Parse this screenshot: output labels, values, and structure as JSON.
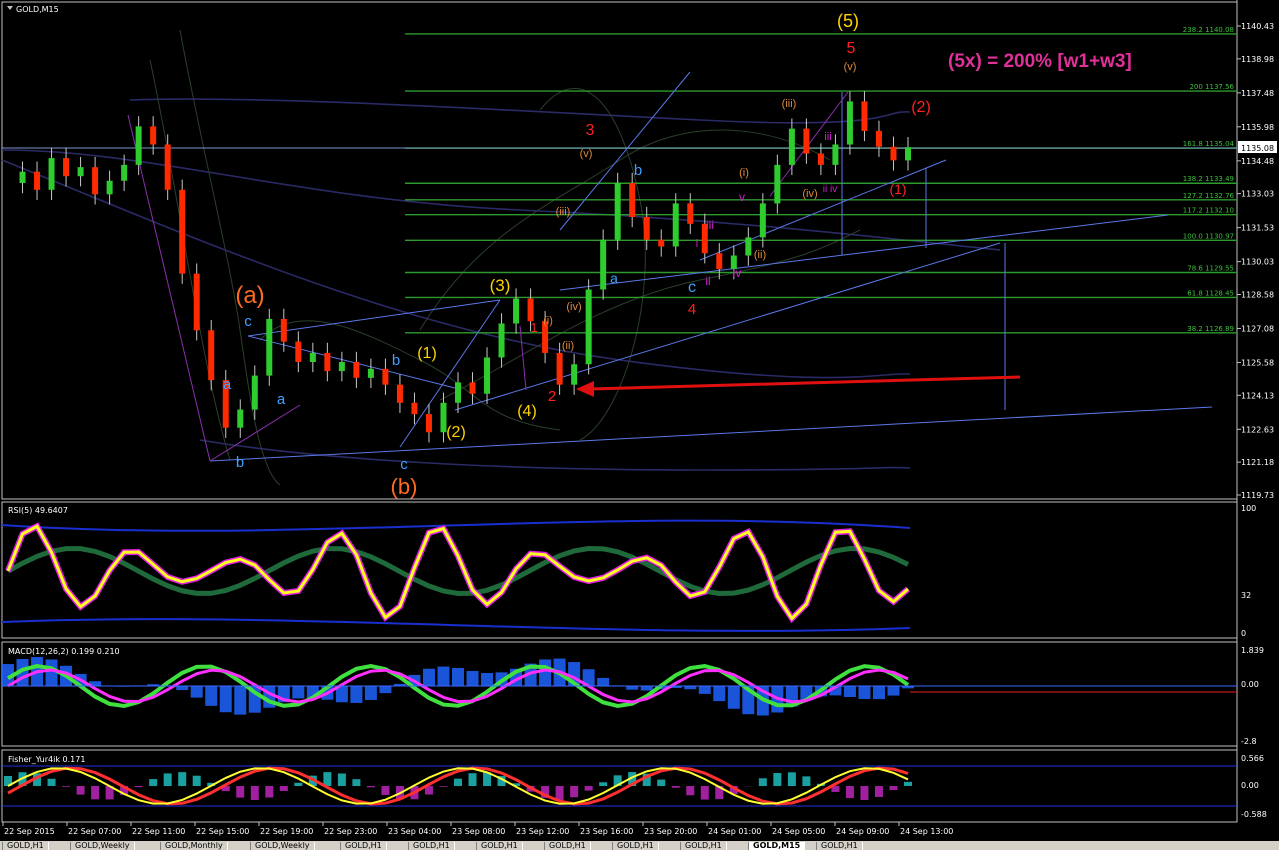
{
  "symbol_label": "GOLD,M15",
  "annotation_big": "(5x)  = 200% [w1+w3]",
  "price_axis": [
    "1140.43",
    "1138.98",
    "1137.48",
    "1135.98",
    "1134.48",
    "1133.03",
    "1131.53",
    "1130.03",
    "1128.58",
    "1127.08",
    "1125.58",
    "1124.13",
    "1122.63",
    "1121.18",
    "1119.73"
  ],
  "current_price": "1135.08",
  "time_axis": [
    "22 Sep 2015",
    "22 Sep 07:00",
    "22 Sep 11:00",
    "22 Sep 15:00",
    "22 Sep 19:00",
    "22 Sep 23:00",
    "23 Sep 04:00",
    "23 Sep 08:00",
    "23 Sep 12:00",
    "23 Sep 16:00",
    "23 Sep 20:00",
    "24 Sep 01:00",
    "24 Sep 05:00",
    "24 Sep 09:00",
    "24 Sep 13:00"
  ],
  "fib_levels": [
    {
      "label": "238.2 1140.08",
      "price": 1140.08
    },
    {
      "label": "200 1137.56",
      "price": 1137.56
    },
    {
      "label": "161.8 1135.04",
      "price": 1135.04
    },
    {
      "label": "138.2 1133.49",
      "price": 1133.49
    },
    {
      "label": "127.2 1132.76",
      "price": 1132.76
    },
    {
      "label": "117.2 1132.10",
      "price": 1132.1
    },
    {
      "label": "100.0 1130.97",
      "price": 1130.97
    },
    {
      "label": "78.6 1129.55",
      "price": 1129.55
    },
    {
      "label": "61.8 1128.45",
      "price": 1128.45
    },
    {
      "label": "38.2 1126.89",
      "price": 1126.89
    }
  ],
  "wave_labels": [
    {
      "text": "(5)",
      "color": "#ffd400"
    },
    {
      "text": "5",
      "color": "#ff2020"
    },
    {
      "text": "(v)",
      "color": "#e08a3c"
    },
    {
      "text": "(2)",
      "color": "#ff2020"
    },
    {
      "text": "(iii)",
      "color": "#e08a3c"
    },
    {
      "text": "iii",
      "color": "#d020d0"
    },
    {
      "text": "(iv)",
      "color": "#e08a3c"
    },
    {
      "text": "ii iv",
      "color": "#d020d0"
    },
    {
      "text": "(1)",
      "color": "#ff2020"
    },
    {
      "text": "3",
      "color": "#ff2020"
    },
    {
      "text": "(v)",
      "color": "#e08a3c"
    },
    {
      "text": "b",
      "color": "#3fa0ff"
    },
    {
      "text": "(i)",
      "color": "#e08a3c"
    },
    {
      "text": "v",
      "color": "#d020d0"
    },
    {
      "text": "iii",
      "color": "#d020d0"
    },
    {
      "text": "i",
      "color": "#d020d0"
    },
    {
      "text": "(iii)",
      "color": "#e08a3c"
    },
    {
      "text": "(ii)",
      "color": "#e08a3c"
    },
    {
      "text": "iv",
      "color": "#d020d0"
    },
    {
      "text": "ii",
      "color": "#d020d0"
    },
    {
      "text": "a",
      "color": "#3fa0ff"
    },
    {
      "text": "c",
      "color": "#3fa0ff"
    },
    {
      "text": "4",
      "color": "#ff2020"
    },
    {
      "text": "(iv)",
      "color": "#e08a3c"
    },
    {
      "text": "(a)",
      "color": "#ff6a20"
    },
    {
      "text": "c",
      "color": "#3fa0ff"
    },
    {
      "text": "(3)",
      "color": "#ffd400"
    },
    {
      "text": "1",
      "color": "#ff2020"
    },
    {
      "text": "(i)",
      "color": "#e08a3c"
    },
    {
      "text": "(ii)",
      "color": "#e08a3c"
    },
    {
      "text": "(1)",
      "color": "#ffd400"
    },
    {
      "text": "b",
      "color": "#3fa0ff"
    },
    {
      "text": "a",
      "color": "#3fa0ff"
    },
    {
      "text": "a",
      "color": "#3fa0ff"
    },
    {
      "text": "(4)",
      "color": "#ffd400"
    },
    {
      "text": "2",
      "color": "#ff2020"
    },
    {
      "text": "(2)",
      "color": "#ffd400"
    },
    {
      "text": "b",
      "color": "#3fa0ff"
    },
    {
      "text": "c",
      "color": "#3fa0ff"
    },
    {
      "text": "(b)",
      "color": "#ff6a20"
    }
  ],
  "rsi": {
    "label": "RSI(5) 49.6407",
    "levels": [
      "100",
      "32",
      "0"
    ]
  },
  "macd": {
    "label": "MACD(12,26,2) 0.199 0.210",
    "levels": [
      "1.839",
      "0.00",
      "-2.8"
    ]
  },
  "fisher": {
    "label": "Fisher_Yur4ik 0.171",
    "levels": [
      "0.566",
      "0.00",
      "-0.588"
    ]
  },
  "tabs": [
    "GOLD,H1",
    "GOLD,Weekly",
    "GOLD,Monthly",
    "GOLD,Weekly",
    "GOLD,H1",
    "GOLD,H1",
    "GOLD,H1",
    "GOLD,H1",
    "GOLD,H1",
    "GOLD,H1",
    "GOLD,M15",
    "GOLD,H1"
  ],
  "active_tab": 10,
  "chart_data": {
    "type": "candlestick",
    "title": "GOLD,M15",
    "ylim": [
      1119.73,
      1140.43
    ],
    "x_range": [
      "22 Sep 2015",
      "24 Sep 13:00"
    ],
    "close_series": [
      1133.5,
      1134.0,
      1133.2,
      1134.6,
      1133.8,
      1134.2,
      1133.0,
      1133.6,
      1134.3,
      1136.0,
      1135.2,
      1133.2,
      1129.5,
      1127.0,
      1124.8,
      1122.7,
      1123.5,
      1125.0,
      1127.5,
      1126.5,
      1125.6,
      1126.0,
      1125.2,
      1125.6,
      1124.9,
      1125.3,
      1124.6,
      1123.8,
      1123.3,
      1122.5,
      1123.8,
      1124.7,
      1124.2,
      1125.8,
      1127.3,
      1128.4,
      1127.4,
      1126.0,
      1124.6,
      1125.5,
      1128.8,
      1131.0,
      1133.5,
      1132.0,
      1131.0,
      1130.7,
      1132.6,
      1131.7,
      1130.4,
      1129.7,
      1130.3,
      1131.1,
      1132.6,
      1134.3,
      1135.9,
      1134.8,
      1134.3,
      1135.2,
      1137.1,
      1135.8,
      1135.1,
      1134.5,
      1135.08
    ]
  }
}
